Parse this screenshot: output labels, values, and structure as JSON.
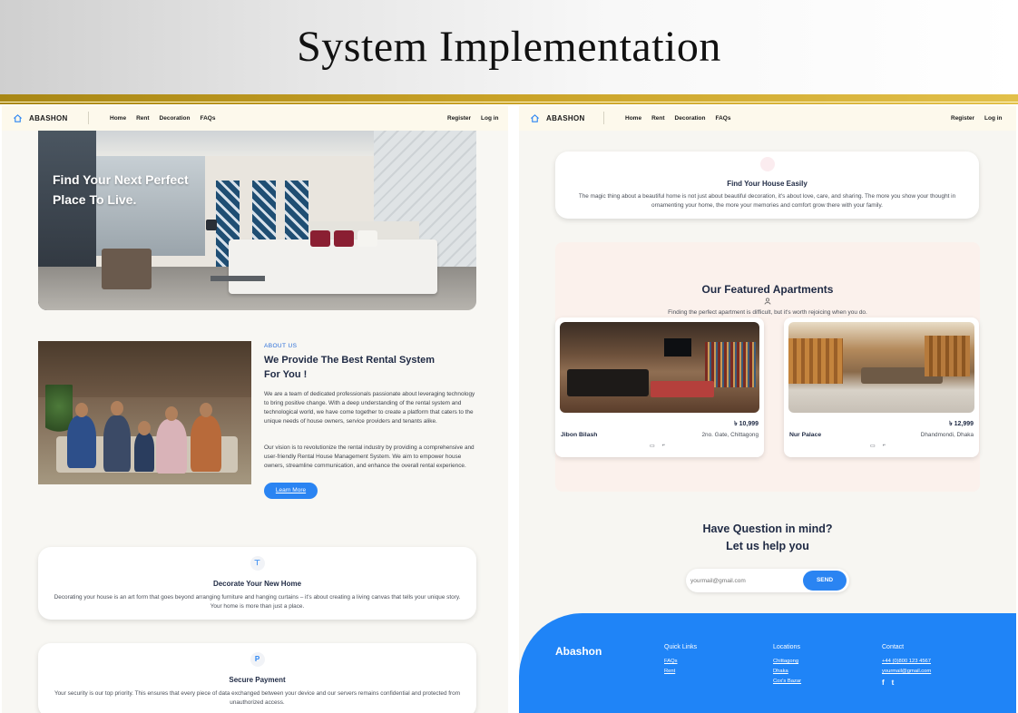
{
  "slide": {
    "title": "System Implementation"
  },
  "colors": {
    "accent": "#2a84f2",
    "footer": "#1f84f7",
    "nav_bg": "#fdf9ec",
    "gold": "#c9a227"
  },
  "left": {
    "nav": {
      "brand": "ABASHON",
      "links": [
        "Home",
        "Rent",
        "Decoration",
        "FAQs"
      ],
      "register": "Register",
      "login": "Log in"
    },
    "hero": {
      "text": "Find Your Next Perfect Place To Live."
    },
    "about": {
      "label": "ABOUT US",
      "title": "We Provide The Best Rental System For You !",
      "p1": "We are a team of dedicated professionals passionate about leveraging technology to bring positive change. With a deep understanding of the rental system and technological world, we have come together to create a platform that caters to the unique needs of house owners, service providers and tenants alike.",
      "p2": "Our vision is to revolutionize the rental industry by providing a comprehensive and user-friendly Rental House Management System. We aim to empower house owners, streamline communication, and enhance the overall rental experience.",
      "button": "Learn More"
    },
    "cards": [
      {
        "icon": "paint-roller-icon",
        "title": "Decorate Your New Home",
        "desc": "Decorating your house is an art form that goes beyond arranging furniture and hanging curtains – it's about creating a living canvas that tells your unique story. Your home is more than just a place."
      },
      {
        "icon": "paypal-icon",
        "title": "Secure Payment",
        "desc": "Your security is our top priority. This ensures that every piece of data exchanged between your device and our servers remains confidential and protected from unauthorized access."
      }
    ]
  },
  "right": {
    "nav": {
      "brand": "ABASHON",
      "links": [
        "Home",
        "Rent",
        "Decoration",
        "FAQs"
      ],
      "register": "Register",
      "login": "Log in"
    },
    "find_card": {
      "title": "Find Your House Easily",
      "desc": "The magic thing about a beautiful home is not just about beautiful decoration, it's about love, care, and sharing. The more you show your thought in ornamenting your home, the more your memories and comfort grow there with your family."
    },
    "featured": {
      "title": "Our Featured Apartments",
      "subtitle": "Finding the perfect apartment is difficult, but it's worth rejoicing when you do.",
      "apartments": [
        {
          "price": "৳ 10,999",
          "name": "Jibon Bilash",
          "location": "2no. Gate, Chittagong"
        },
        {
          "price": "৳ 12,999",
          "name": "Nur Palace",
          "location": "Dhandmondi, Dhaka"
        }
      ]
    },
    "question": {
      "line1": "Have Question in mind?",
      "line2": "Let us help you",
      "placeholder": "yourmail@gmail.com",
      "send": "SEND"
    },
    "footer": {
      "brand": "Abashon",
      "quick_links": {
        "heading": "Quick Links",
        "items": [
          "FAQs",
          "Rent"
        ]
      },
      "locations": {
        "heading": "Locations",
        "items": [
          "Chittagong",
          "Dhaka",
          "Cox's Bazar"
        ]
      },
      "contact": {
        "heading": "Contact",
        "phone": "+44 (0)800 123 4567",
        "email": "yourmail@gmail.com"
      }
    }
  }
}
